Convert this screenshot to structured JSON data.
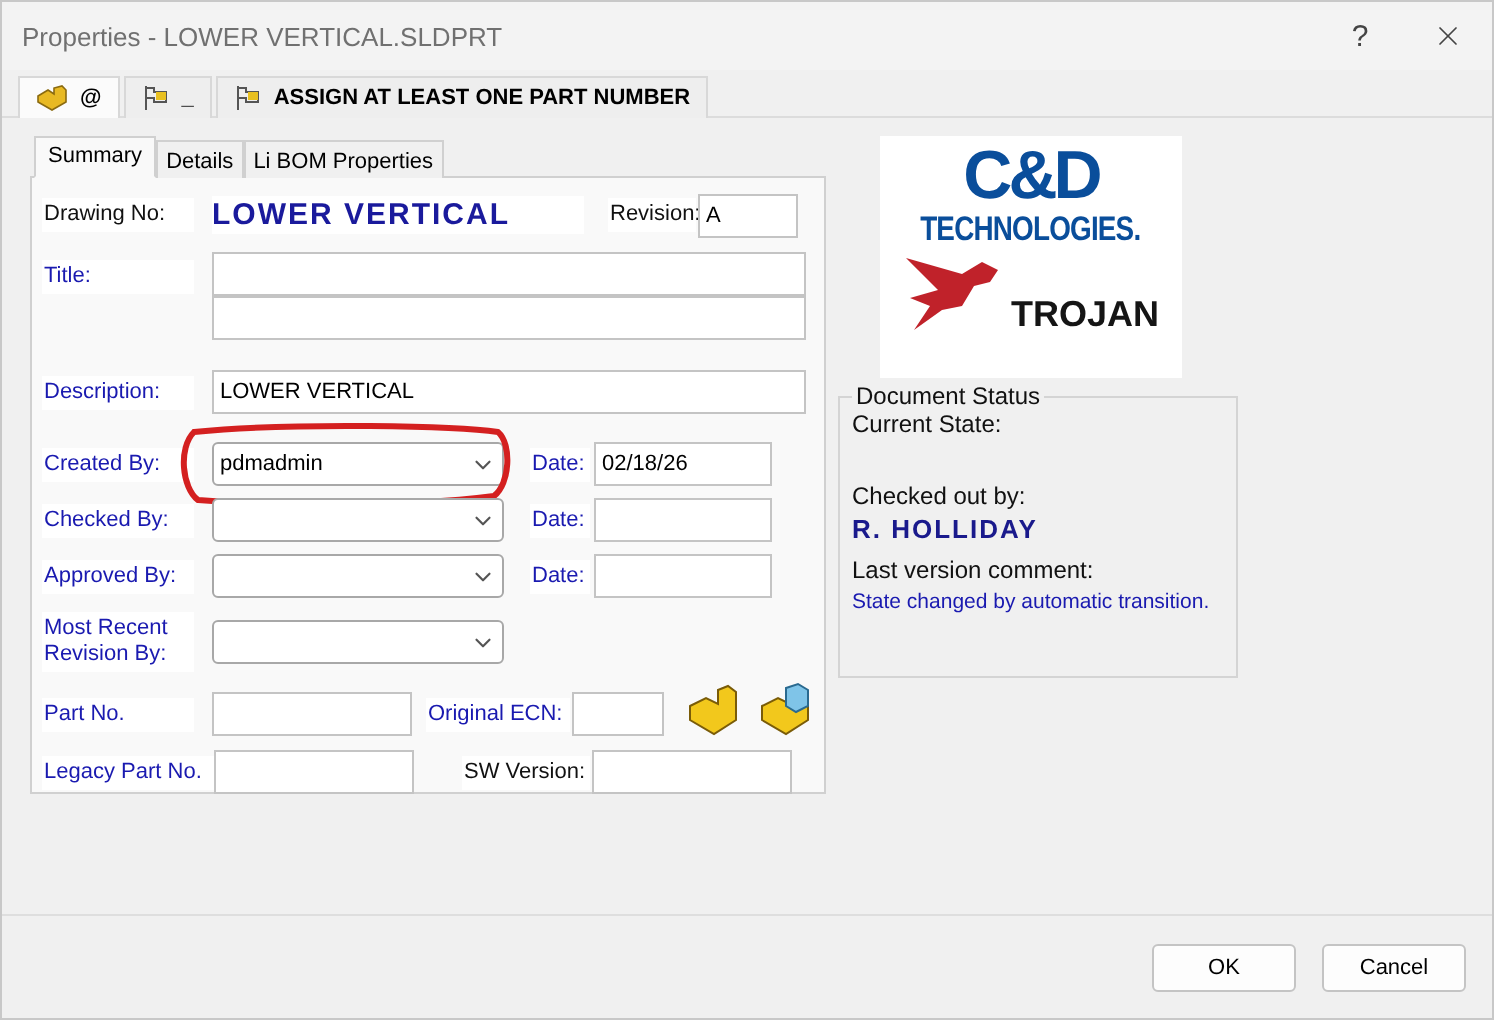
{
  "window": {
    "title": "Properties - LOWER VERTICAL.SLDPRT",
    "help": "?"
  },
  "config_tabs": [
    {
      "kind": "part",
      "label": "@",
      "selected": true
    },
    {
      "kind": "flag",
      "label": "_",
      "selected": false
    },
    {
      "kind": "flag",
      "label": "ASSIGN AT LEAST ONE PART NUMBER",
      "selected": false
    }
  ],
  "tabs": [
    {
      "label": "Summary",
      "selected": true
    },
    {
      "label": "Details",
      "selected": false
    },
    {
      "label": "Li BOM Properties",
      "selected": false
    }
  ],
  "drawing_no": {
    "label": "Drawing No:",
    "value": "LOWER VERTICAL"
  },
  "revision": {
    "label": "Revision:",
    "value": "A"
  },
  "title": {
    "label": "Title:"
  },
  "description": {
    "label": "Description:",
    "value": "LOWER VERTICAL"
  },
  "people": [
    {
      "label": "Created By:",
      "value": "pdmadmin",
      "date_label": "Date:",
      "date": "02/18/26",
      "annotated": true
    },
    {
      "label": "Checked By:",
      "date_label": "Date:",
      "annotated": false
    },
    {
      "label": "Approved By:",
      "date_label": "Date:",
      "annotated": false
    },
    {
      "label": "Most Recent Revision By:",
      "annotated": false
    }
  ],
  "part_no": {
    "label": "Part No.",
    "ecn_label": "Original ECN:"
  },
  "legacy": {
    "label": "Legacy Part No.",
    "sw_label": "SW Version:"
  },
  "logo": {
    "mark": "C&D",
    "name": "TECHNOLOGIES.",
    "brand": "TROJAN"
  },
  "document_status": {
    "legend": "Document Status",
    "current_state": "Current State:",
    "checked_out_label": "Checked out by:",
    "checked_out_by": "R. HOLLIDAY",
    "comment_label": "Last version comment:",
    "comment": "State changed by automatic transition."
  },
  "buttons": [
    "OK",
    "Cancel"
  ]
}
